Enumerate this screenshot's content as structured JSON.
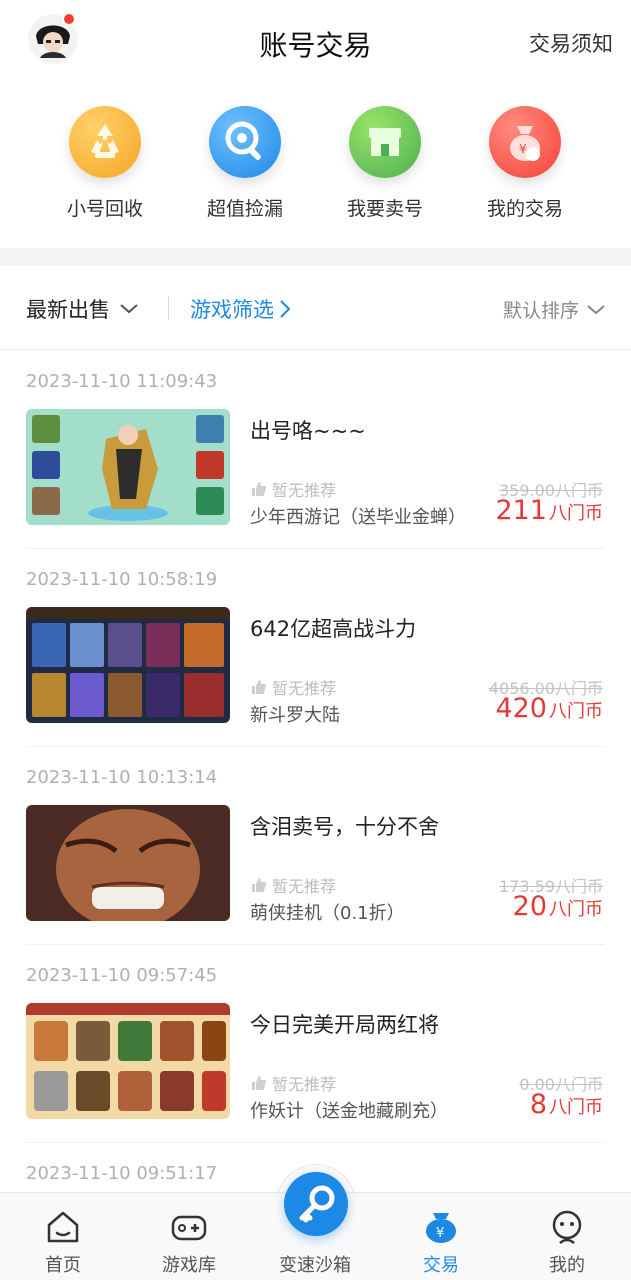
{
  "header": {
    "title": "账号交易",
    "notice_link": "交易须知"
  },
  "quick_actions": [
    {
      "label": "小号回收",
      "icon": "recycle-icon",
      "color": "#f5a623"
    },
    {
      "label": "超值捡漏",
      "icon": "magnifier-icon",
      "color": "#2196f3"
    },
    {
      "label": "我要卖号",
      "icon": "shop-icon",
      "color": "#4caf50"
    },
    {
      "label": "我的交易",
      "icon": "money-bag-icon",
      "color": "#f44336"
    }
  ],
  "filters": {
    "latest": "最新出售",
    "game_filter": "游戏筛选",
    "sort": "默认排序"
  },
  "listings": [
    {
      "time": "2023-11-10 11:09:43",
      "title": "出号咯~~~",
      "recommend": "暂无推荐",
      "game": "少年西游记（送毕业金蝉）",
      "original_price": "359.00八门币",
      "price": "211",
      "unit": "八门币"
    },
    {
      "time": "2023-11-10 10:58:19",
      "title": "642亿超高战斗力",
      "recommend": "暂无推荐",
      "game": "新斗罗大陆",
      "original_price": "4056.00八门币",
      "price": "420",
      "unit": "八门币"
    },
    {
      "time": "2023-11-10 10:13:14",
      "title": "含泪卖号，十分不舍",
      "recommend": "暂无推荐",
      "game": "萌侠挂机（0.1折）",
      "original_price": "173.59八门币",
      "price": "20",
      "unit": "八门币"
    },
    {
      "time": "2023-11-10 09:57:45",
      "title": "今日完美开局两红将",
      "recommend": "暂无推荐",
      "game": "作妖计（送金地藏刷充）",
      "original_price": "0.00八门币",
      "price": "8",
      "unit": "八门币"
    },
    {
      "time": "2023-11-10 09:51:17"
    }
  ],
  "tabbar": {
    "tabs": [
      {
        "label": "首页",
        "icon": "home-icon"
      },
      {
        "label": "游戏库",
        "icon": "gamepad-icon"
      },
      {
        "label": "变速沙箱",
        "icon": "key-icon"
      },
      {
        "label": "交易",
        "icon": "trade-bag-icon"
      },
      {
        "label": "我的",
        "icon": "profile-icon"
      }
    ],
    "active": "交易",
    "accent": "#1e88e5"
  }
}
